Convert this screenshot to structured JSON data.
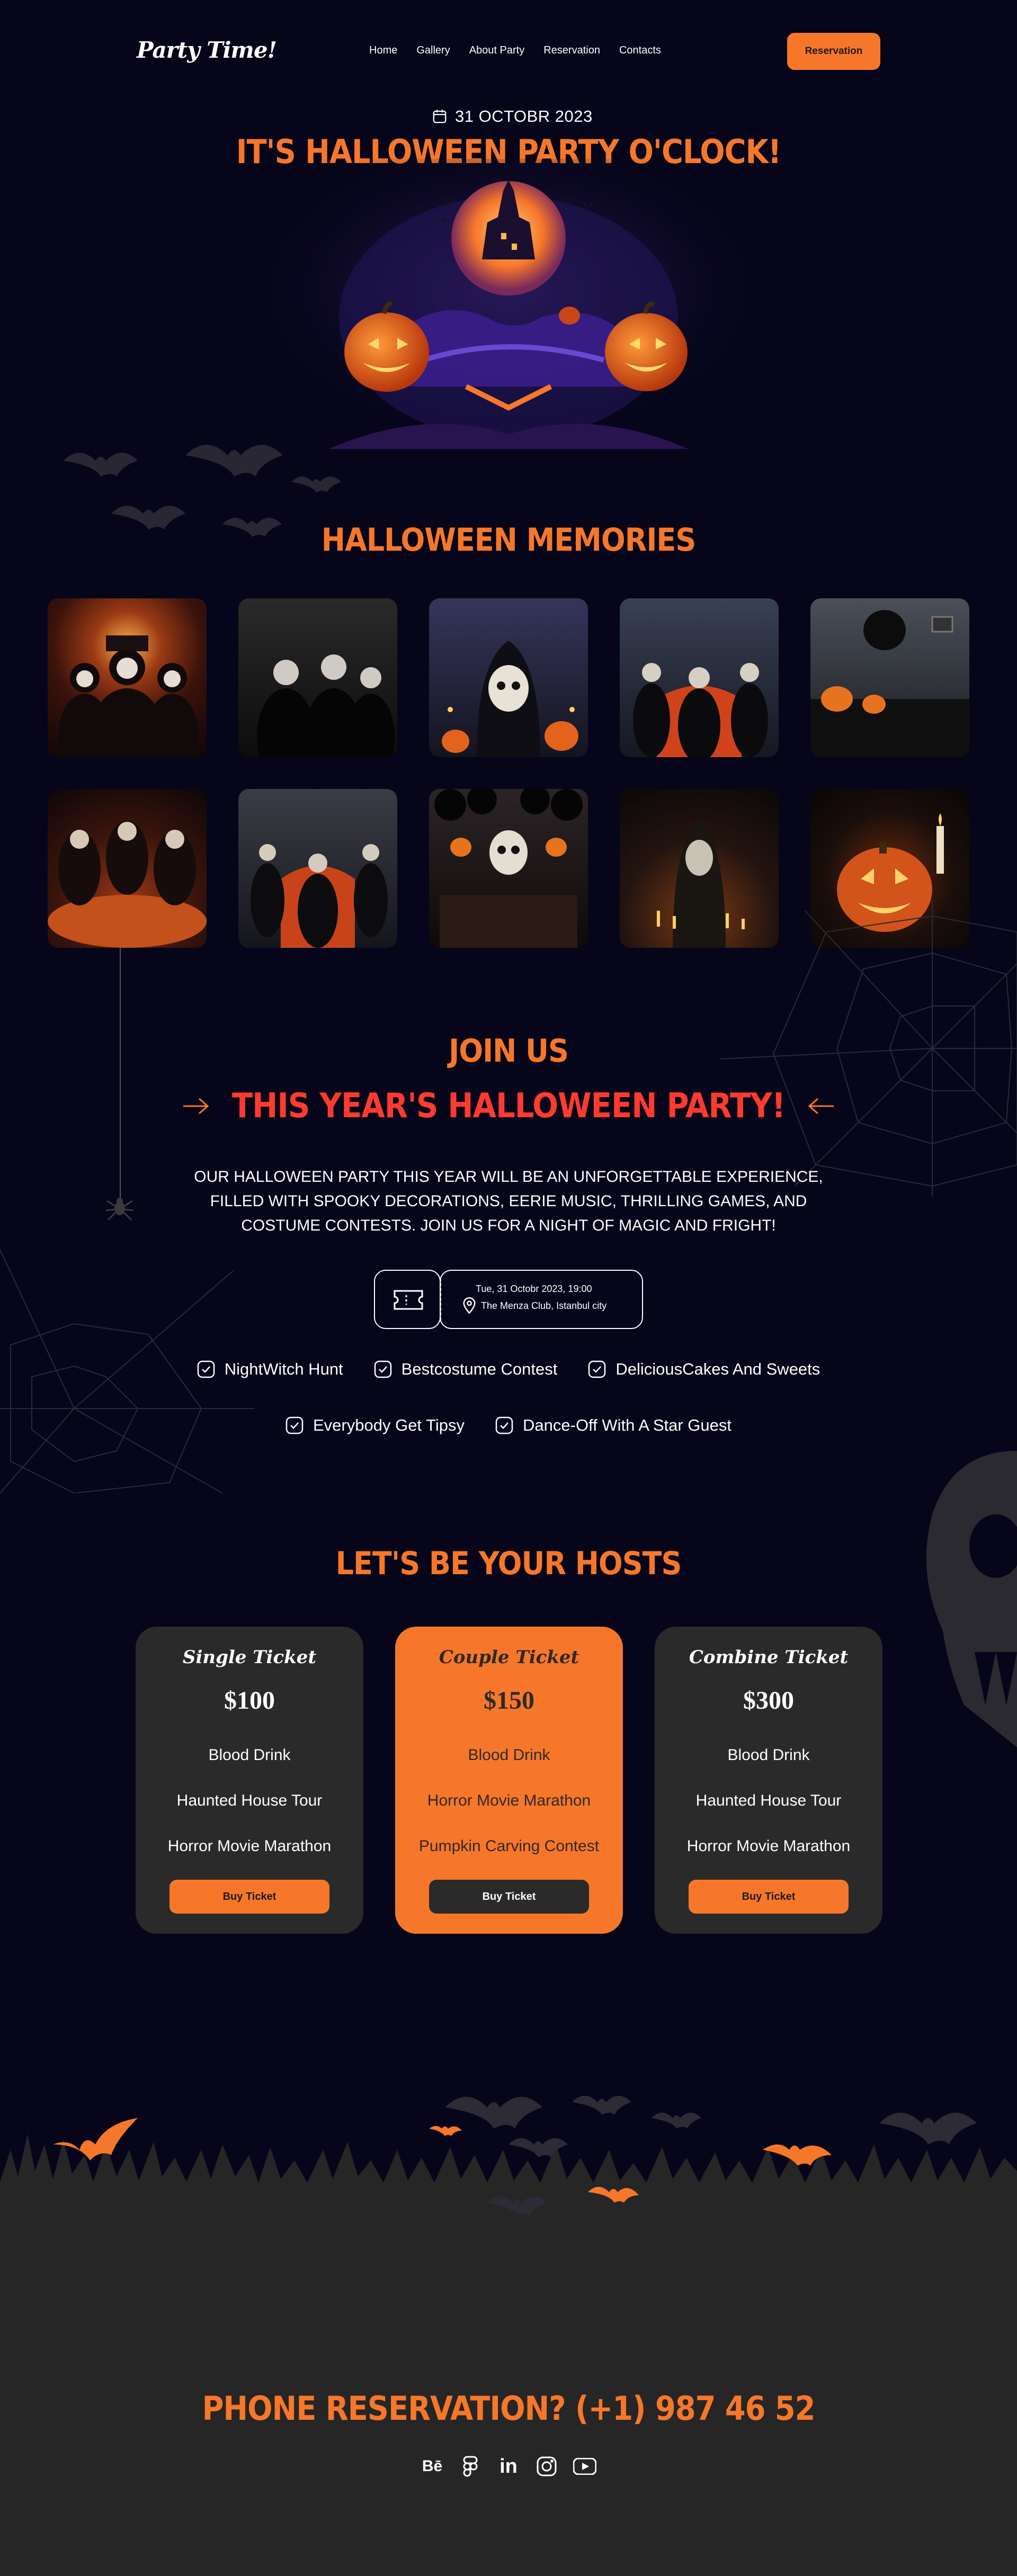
{
  "header": {
    "logo": "Party Time!",
    "nav": [
      "Home",
      "Gallery",
      "About Party",
      "Reservation",
      "Contacts"
    ],
    "cta": "Reservation"
  },
  "hero": {
    "date": "31 OCTOBR 2023",
    "title": "IT'S HALLOWEEN PARTY O'CLOCK!"
  },
  "memories": {
    "title": "HALLOWEEN MEMORIES",
    "photos": [
      "photo-costumed-trio",
      "photo-gothic-group",
      "photo-skull-host",
      "photo-armchair-group",
      "photo-pumpkin-room",
      "photo-table-party",
      "photo-red-chair",
      "photo-skull-dinner",
      "photo-masked-figures",
      "photo-jack-o-lantern"
    ]
  },
  "join": {
    "title": "JOIN US",
    "subtitle": "THIS YEAR'S HALLOWEEN PARTY!",
    "description": "OUR HALLOWEEN PARTY THIS YEAR WILL BE AN UNFORGETTABLE EXPERIENCE, FILLED WITH SPOOKY DECORATIONS, EERIE MUSIC, THRILLING GAMES, AND COSTUME CONTESTS. JOIN US FOR A NIGHT OF MAGIC AND FRIGHT!",
    "event_date": "Tue, 31 Octobr 2023, 19:00",
    "event_location": "The Menza Club, Istanbul city",
    "features_row1": [
      "NightWitch Hunt",
      "Bestcostume Contest",
      "DeliciousCakes And Sweets"
    ],
    "features_row2": [
      "Everybody Get Tipsy",
      "Dance-Off With A Star Guest"
    ]
  },
  "hosts": {
    "title": "LET'S BE YOUR HOSTS",
    "cards": [
      {
        "name": "Single Ticket",
        "price": "$100",
        "features": [
          "Blood Drink",
          "Haunted House Tour",
          "Horror Movie Marathon"
        ],
        "button": "Buy Ticket"
      },
      {
        "name": "Couple Ticket",
        "price": "$150",
        "features": [
          "Blood Drink",
          "Horror Movie Marathon",
          "Pumpkin Carving Contest"
        ],
        "button": "Buy Ticket"
      },
      {
        "name": "Combine Ticket",
        "price": "$300",
        "features": [
          "Blood Drink",
          "Haunted House Tour",
          "Horror Movie Marathon"
        ],
        "button": "Buy Ticket"
      }
    ]
  },
  "footer": {
    "phone": "PHONE RESERVATION? (+1) 987 46 52",
    "socials": [
      "behance-icon",
      "figma-icon",
      "linkedin-icon",
      "instagram-icon",
      "youtube-icon"
    ],
    "social_labels": {
      "behance": "Bē",
      "linkedin": "in"
    }
  },
  "colors": {
    "background": "#06051a",
    "accent": "#f7772a",
    "accent_red": "#ff3a2e",
    "card": "#2b2a2a",
    "footer": "#262626"
  }
}
